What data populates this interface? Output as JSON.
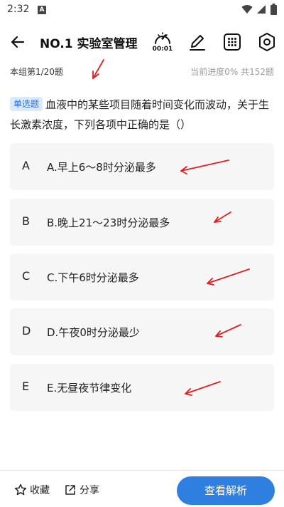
{
  "status_bar": {
    "time": "2:32",
    "notif_letter": "A"
  },
  "header": {
    "title": "NO.1 实验室管理",
    "timer": "00:01"
  },
  "progress": {
    "group": "本组第1/20题",
    "current": "当前进度0%",
    "total": "共152题"
  },
  "question": {
    "type": "单选题",
    "text": "血液中的某些项目随着时间变化而波动，关于生长激素浓度，下列各项中正确的是（）"
  },
  "options": [
    {
      "letter": "A",
      "text": "A.早上6～8时分泌最多"
    },
    {
      "letter": "B",
      "text": "B.晚上21～23时分泌最多"
    },
    {
      "letter": "C",
      "text": "C.下午6时分泌最多"
    },
    {
      "letter": "D",
      "text": "D.午夜0时分泌最少"
    },
    {
      "letter": "E",
      "text": "E.无昼夜节律变化"
    }
  ],
  "footer": {
    "favorite": "收藏",
    "share": "分享",
    "analysis": "查看解析"
  },
  "colors": {
    "accent": "#2f7fe0",
    "badge_bg": "#dbe9fb",
    "annotation_arrow": "#e02020",
    "option_bg": "#f6f6f6"
  },
  "icons": [
    "back-arrow-icon",
    "stopwatch-icon",
    "pencil-icon",
    "grid-icon",
    "hexagon-settings-icon",
    "star-icon",
    "share-icon",
    "wifi-icon",
    "signal-icon",
    "battery-icon"
  ]
}
